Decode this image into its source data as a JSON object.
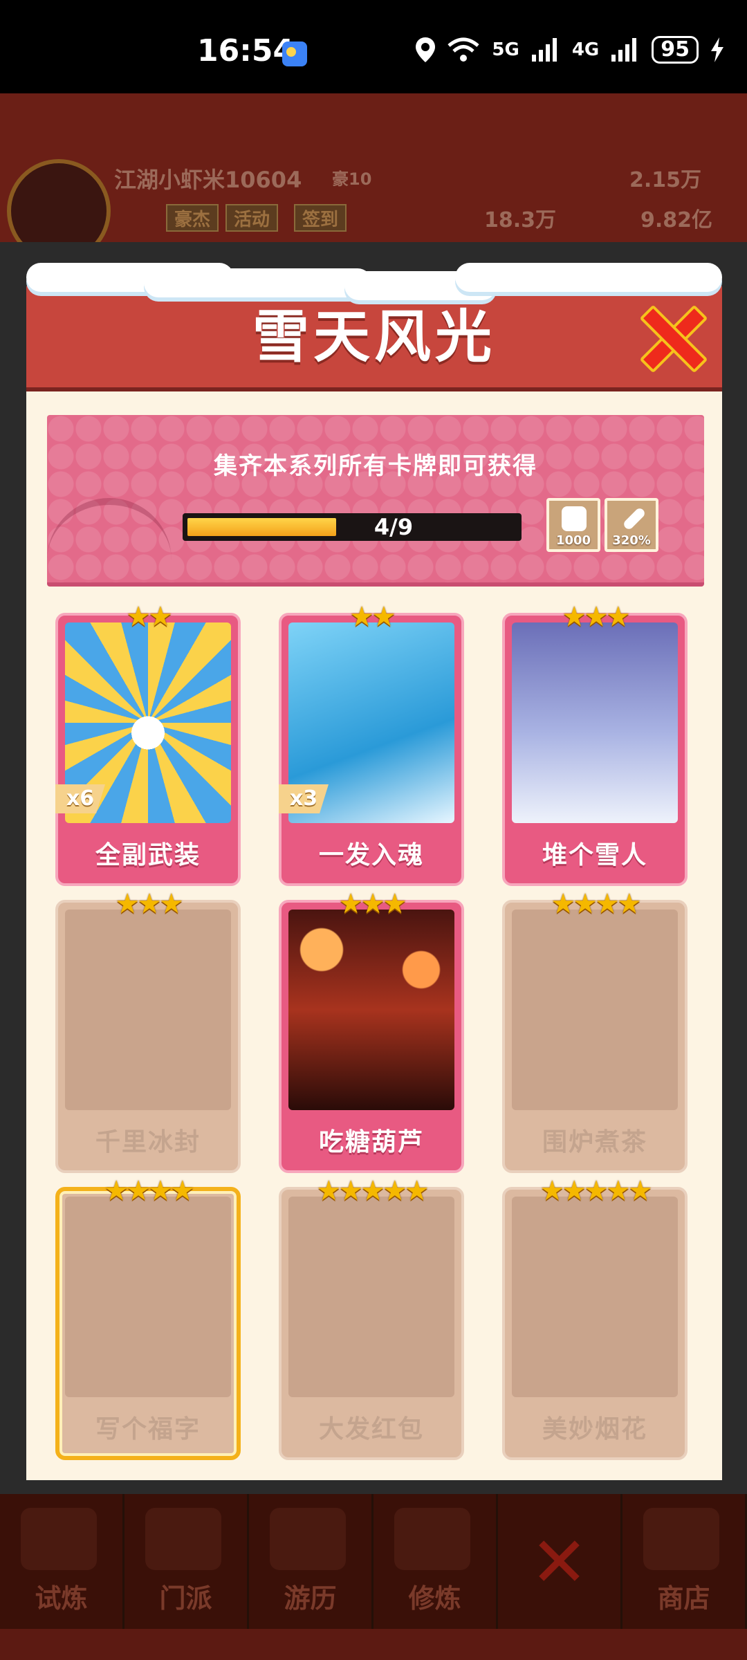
{
  "status_bar": {
    "time": "16:54",
    "network_5g": "5G",
    "network_4g": "4G",
    "battery": "95"
  },
  "background": {
    "player_name": "江湖小虾米10604",
    "player_level": "豪10",
    "gems": "2.15万",
    "power": "18.3万",
    "coins": "9.82亿",
    "buttons": [
      "豪杰",
      "活动",
      "签到"
    ],
    "bottom_tabs": [
      "试炼",
      "门派",
      "游历",
      "修炼",
      "",
      "商店"
    ]
  },
  "dialog": {
    "title": "雪天风光",
    "banner_text": "集齐本系列所有卡牌即可获得",
    "progress": {
      "current": 4,
      "total": 9,
      "label": "4/9",
      "fraction": 0.444
    },
    "rewards": [
      {
        "icon": "dice-icon",
        "value": "1000"
      },
      {
        "icon": "sword-icon",
        "value": "320%"
      }
    ],
    "cards": [
      {
        "name": "全副武装",
        "stars": "★★",
        "count": "x6",
        "owned": true,
        "art": "art-1"
      },
      {
        "name": "一发入魂",
        "stars": "★★",
        "count": "x3",
        "owned": true,
        "art": "art-2"
      },
      {
        "name": "堆个雪人",
        "stars": "★★★",
        "count": "",
        "owned": true,
        "art": "art-3"
      },
      {
        "name": "千里冰封",
        "stars": "★★★",
        "count": "",
        "owned": false,
        "art": ""
      },
      {
        "name": "吃糖葫芦",
        "stars": "★★★",
        "count": "",
        "owned": true,
        "art": "art-5"
      },
      {
        "name": "围炉煮茶",
        "stars": "★★★★",
        "count": "",
        "owned": false,
        "art": ""
      },
      {
        "name": "写个福字",
        "stars": "★★★★",
        "count": "",
        "owned": false,
        "art": "",
        "gold": true
      },
      {
        "name": "大发红包",
        "stars": "★★★★★",
        "count": "",
        "owned": false,
        "art": ""
      },
      {
        "name": "美妙烟花",
        "stars": "★★★★★",
        "count": "",
        "owned": false,
        "art": ""
      }
    ]
  },
  "colors": {
    "header_red": "#c7463d",
    "banner_pink": "#e36a8a",
    "card_pink": "#e85a82",
    "locked_tan": "#dcb9a0",
    "star_gold": "#f5b800"
  }
}
